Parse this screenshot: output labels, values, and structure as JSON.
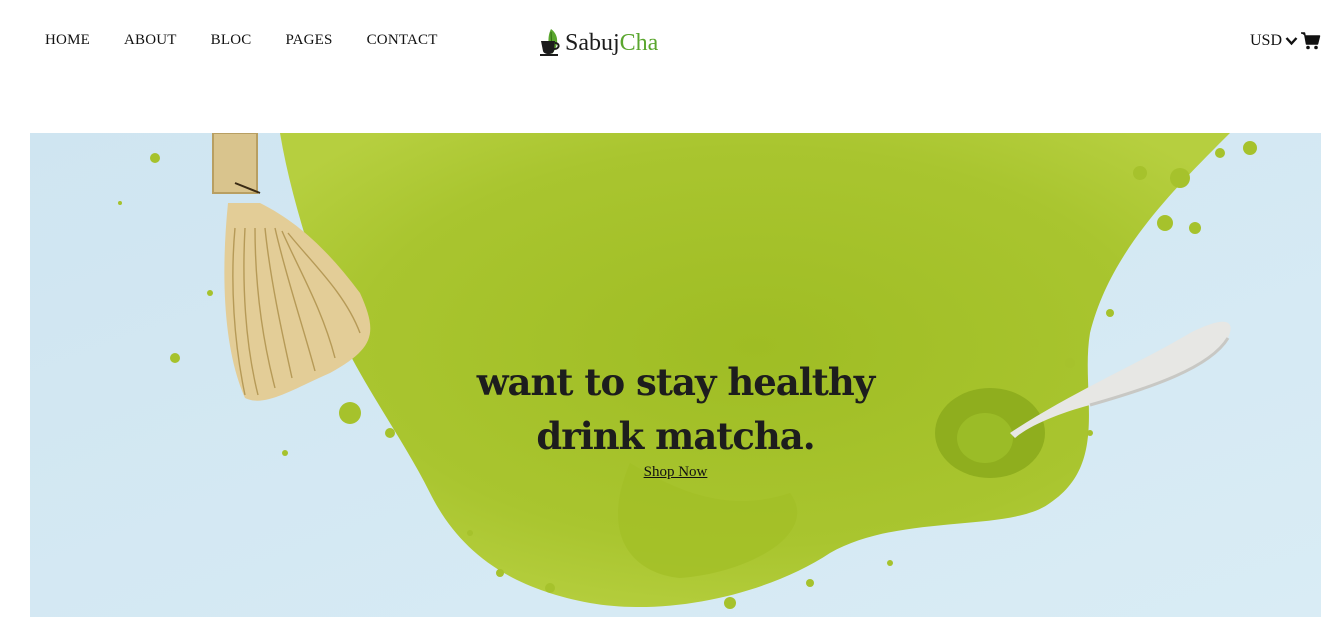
{
  "nav": {
    "items": [
      {
        "label": "HOME"
      },
      {
        "label": "ABOUT"
      },
      {
        "label": "BLOC"
      },
      {
        "label": "PAGES"
      },
      {
        "label": "CONTACT"
      }
    ]
  },
  "logo": {
    "part1": "Sabuj",
    "part2": "Cha",
    "icon": "teacup-leaf-icon",
    "colors": {
      "dark": "#1c1c1c",
      "green": "#5aa62e"
    }
  },
  "header_tools": {
    "currency": "USD",
    "currency_icon": "chevron-down-icon",
    "cart_icon": "cart-icon"
  },
  "hero": {
    "headline_line1": "want to stay healthy",
    "headline_line2": "drink matcha.",
    "cta": "Shop Now",
    "colors": {
      "background": "#d3e8f3",
      "matcha": "#a4c02a"
    }
  }
}
